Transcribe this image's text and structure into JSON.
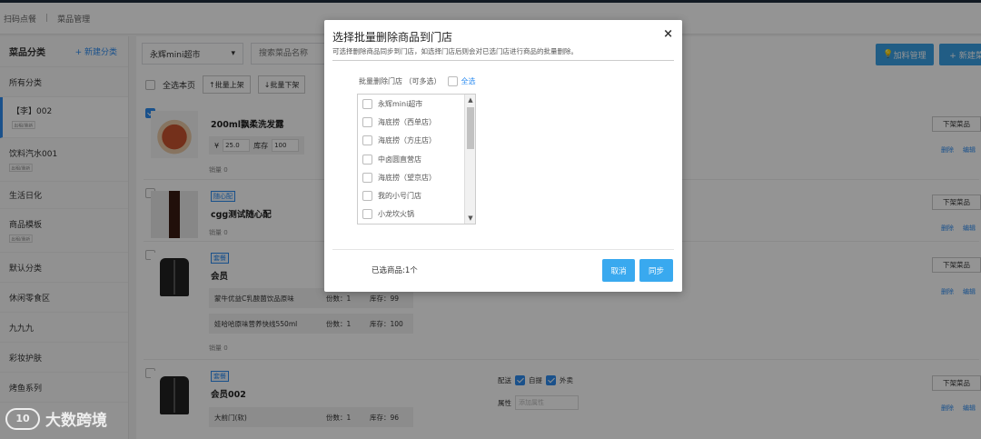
{
  "breadcrumb": {
    "items": [
      "扫码点餐",
      "菜品管理"
    ]
  },
  "sidebar": {
    "title": "菜品分类",
    "add_label": "+ 新建分类",
    "items": [
      {
        "label": "所有分类",
        "tag": ""
      },
      {
        "label": "【李】002",
        "tag": "出租/重新"
      },
      {
        "label": "饮料汽水001",
        "tag": "出租/重新"
      },
      {
        "label": "生活日化",
        "tag": ""
      },
      {
        "label": "商品模板",
        "tag": "出租/重新"
      },
      {
        "label": "默认分类",
        "tag": ""
      },
      {
        "label": "休闲零食区",
        "tag": ""
      },
      {
        "label": "九九九",
        "tag": ""
      },
      {
        "label": "彩妆护肤",
        "tag": ""
      },
      {
        "label": "烤鱼系列",
        "tag": ""
      }
    ]
  },
  "toolbar": {
    "store_select": "永辉mini超市",
    "search_placeholder": "搜索菜品名称",
    "addon_button": "加料管理",
    "new_button": "+ 新建菜"
  },
  "bulkbar": {
    "select_page": "全选本页",
    "bulk_on": "↑批量上架",
    "bulk_off": "↓批量下架"
  },
  "products": [
    {
      "title": "200ml飘柔洗发露",
      "tag": "",
      "price": "25.0",
      "stock": "100",
      "sold": "销量 0",
      "currency": "¥",
      "stock_label": "库存",
      "off_label": "下架菜品",
      "delete": "删除",
      "edit": "编辑"
    },
    {
      "title": "cgg测试随心配",
      "tag": "随心配",
      "sold": "销量 0",
      "off_label": "下架菜品",
      "delete": "删除",
      "edit": "编辑"
    },
    {
      "title": "会员",
      "tag": "套餐",
      "sold": "销量 0",
      "off_label": "下架菜品",
      "delete": "删除",
      "edit": "编辑",
      "subs": [
        {
          "name": "蒙牛优益C乳酸菌饮品原味",
          "qty": "份数：1",
          "stock": "库存：99"
        },
        {
          "name": "娃哈哈原味营养快线550ml",
          "qty": "份数：1",
          "stock": "库存：100"
        }
      ]
    },
    {
      "title": "会员002",
      "tag": "套餐",
      "off_label": "下架菜品",
      "delete": "删除",
      "edit": "编辑",
      "delivery_label": "配送",
      "self_pickup": "自提",
      "takeout": "外卖",
      "attr_label": "属性",
      "attr_placeholder": "添加属性",
      "subs": [
        {
          "name": "大前门(软)",
          "qty": "份数：1",
          "stock": "库存：96"
        }
      ]
    }
  ],
  "modal": {
    "title": "选择批量删除商品到门店",
    "subtitle": "可选择删除商品同步到门店，如选择门店后则会对已选门店进行商品的批量删除。",
    "close": "×",
    "store_label": "批量删除门店 （可多选）",
    "select_all": "全选",
    "stores": [
      "永辉mini超市",
      "海底捞（西单店）",
      "海底捞（方庄店）",
      "中卤圆直营店",
      "海底捞（望京店）",
      "我的小号门店",
      "小龙坎火锅"
    ],
    "selected_count": "已选商品:1个",
    "cancel": "取消",
    "sync": "同步"
  },
  "watermark": {
    "logo": "10",
    "text": "大数跨境"
  }
}
